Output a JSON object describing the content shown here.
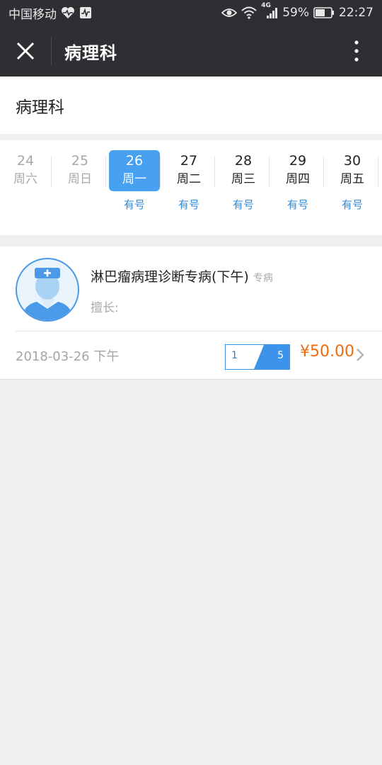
{
  "status_bar": {
    "carrier": "中国移动",
    "network": "4G",
    "battery": "59%",
    "time": "22:27"
  },
  "title_bar": {
    "title": "病理科"
  },
  "department": {
    "name": "病理科"
  },
  "dates": [
    {
      "num": "24",
      "day": "周六",
      "state": "past",
      "availability": ""
    },
    {
      "num": "25",
      "day": "周日",
      "state": "past",
      "availability": ""
    },
    {
      "num": "26",
      "day": "周一",
      "state": "selected",
      "availability": "有号"
    },
    {
      "num": "27",
      "day": "周二",
      "state": "future",
      "availability": "有号"
    },
    {
      "num": "28",
      "day": "周三",
      "state": "future",
      "availability": "有号"
    },
    {
      "num": "29",
      "day": "周四",
      "state": "future",
      "availability": "有号"
    },
    {
      "num": "30",
      "day": "周五",
      "state": "future",
      "availability": "有号"
    }
  ],
  "doctor": {
    "name": "淋巴瘤病理诊断专病(下午)",
    "tag": "专病",
    "skill_label": "擅长:",
    "slot_date": "2018-03-26 下午",
    "slots_used": "1",
    "slots_total": "5",
    "price": "¥50.00"
  },
  "colors": {
    "header_bg": "#2e2f33",
    "accent_blue": "#47a1f0",
    "link_blue": "#2f8ad8",
    "price_orange": "#f06a0e"
  }
}
